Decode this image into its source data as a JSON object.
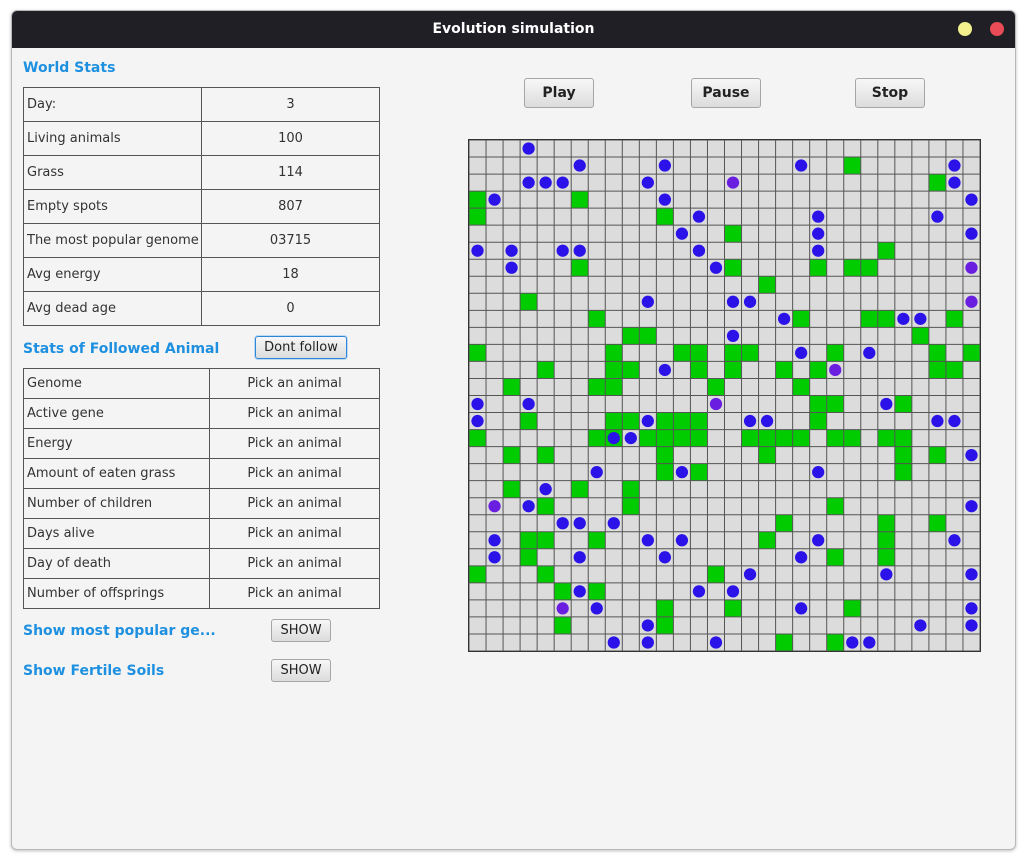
{
  "window": {
    "title": "Evolution simulation",
    "colors": {
      "titlebar": "#1f1f25",
      "minimize": "#f3f08d",
      "close": "#ea4c57"
    }
  },
  "world_stats": {
    "title": "World Stats",
    "rows": [
      {
        "label": "Day:",
        "value": "3"
      },
      {
        "label": "Living animals",
        "value": "100"
      },
      {
        "label": "Grass",
        "value": "114"
      },
      {
        "label": "Empty spots",
        "value": "807"
      },
      {
        "label": "The most popular genome",
        "value": "03715"
      },
      {
        "label": "Avg energy",
        "value": "18"
      },
      {
        "label": "Avg dead age",
        "value": "0"
      }
    ]
  },
  "followed": {
    "title": "Stats of Followed Animal",
    "dont_follow_label": "Dont follow",
    "rows": [
      {
        "label": "Genome",
        "value": "Pick an animal"
      },
      {
        "label": "Active gene",
        "value": "Pick an animal"
      },
      {
        "label": "Energy",
        "value": "Pick an animal"
      },
      {
        "label": "Amount of eaten grass",
        "value": "Pick an animal"
      },
      {
        "label": "Number of children",
        "value": "Pick an animal"
      },
      {
        "label": "Days alive",
        "value": "Pick an animal"
      },
      {
        "label": "Day of death",
        "value": "Pick an animal"
      },
      {
        "label": "Number of offsprings",
        "value": "Pick an animal"
      }
    ]
  },
  "genome_toggle": {
    "label": "Show most popular ge...",
    "button": "SHOW"
  },
  "fertile_toggle": {
    "label": "Show Fertile Soils",
    "button": "SHOW"
  },
  "controls": {
    "play": "Play",
    "pause": "Pause",
    "stop": "Stop"
  },
  "map": {
    "cols": 30,
    "rows": 30,
    "colors": {
      "empty": "#dcdcdc",
      "grass": "#00cc00",
      "animal": "#2a12e8",
      "animal_alt": "#6a1fe0",
      "grid": "#555555"
    },
    "grass": [
      [
        22,
        1
      ],
      [
        27,
        2
      ],
      [
        0,
        3
      ],
      [
        6,
        3
      ],
      [
        0,
        4
      ],
      [
        11,
        4
      ],
      [
        15,
        5
      ],
      [
        24,
        6
      ],
      [
        6,
        7
      ],
      [
        15,
        7
      ],
      [
        20,
        7
      ],
      [
        22,
        7
      ],
      [
        23,
        7
      ],
      [
        17,
        8
      ],
      [
        3,
        9
      ],
      [
        7,
        10
      ],
      [
        19,
        10
      ],
      [
        23,
        10
      ],
      [
        24,
        10
      ],
      [
        28,
        10
      ],
      [
        9,
        11
      ],
      [
        10,
        11
      ],
      [
        26,
        11
      ],
      [
        0,
        12
      ],
      [
        8,
        12
      ],
      [
        12,
        12
      ],
      [
        13,
        12
      ],
      [
        15,
        12
      ],
      [
        16,
        12
      ],
      [
        21,
        12
      ],
      [
        27,
        12
      ],
      [
        29,
        12
      ],
      [
        4,
        13
      ],
      [
        8,
        13
      ],
      [
        9,
        13
      ],
      [
        13,
        13
      ],
      [
        15,
        13
      ],
      [
        18,
        13
      ],
      [
        20,
        13
      ],
      [
        27,
        13
      ],
      [
        28,
        13
      ],
      [
        2,
        14
      ],
      [
        7,
        14
      ],
      [
        8,
        14
      ],
      [
        14,
        14
      ],
      [
        19,
        14
      ],
      [
        20,
        15
      ],
      [
        21,
        15
      ],
      [
        25,
        15
      ],
      [
        3,
        16
      ],
      [
        8,
        16
      ],
      [
        9,
        16
      ],
      [
        11,
        16
      ],
      [
        12,
        16
      ],
      [
        13,
        16
      ],
      [
        20,
        16
      ],
      [
        0,
        17
      ],
      [
        7,
        17
      ],
      [
        8,
        17
      ],
      [
        10,
        17
      ],
      [
        11,
        17
      ],
      [
        12,
        17
      ],
      [
        13,
        17
      ],
      [
        16,
        17
      ],
      [
        17,
        17
      ],
      [
        18,
        17
      ],
      [
        19,
        17
      ],
      [
        21,
        17
      ],
      [
        22,
        17
      ],
      [
        24,
        17
      ],
      [
        25,
        17
      ],
      [
        2,
        18
      ],
      [
        4,
        18
      ],
      [
        11,
        18
      ],
      [
        17,
        18
      ],
      [
        25,
        18
      ],
      [
        27,
        18
      ],
      [
        11,
        19
      ],
      [
        13,
        19
      ],
      [
        25,
        19
      ],
      [
        2,
        20
      ],
      [
        6,
        20
      ],
      [
        9,
        20
      ],
      [
        4,
        21
      ],
      [
        9,
        21
      ],
      [
        21,
        21
      ],
      [
        18,
        22
      ],
      [
        24,
        22
      ],
      [
        27,
        22
      ],
      [
        3,
        23
      ],
      [
        4,
        23
      ],
      [
        7,
        23
      ],
      [
        17,
        23
      ],
      [
        24,
        23
      ],
      [
        3,
        24
      ],
      [
        21,
        24
      ],
      [
        24,
        24
      ],
      [
        0,
        25
      ],
      [
        4,
        25
      ],
      [
        14,
        25
      ],
      [
        5,
        26
      ],
      [
        7,
        26
      ],
      [
        11,
        27
      ],
      [
        15,
        27
      ],
      [
        22,
        27
      ],
      [
        5,
        28
      ],
      [
        11,
        28
      ],
      [
        18,
        29
      ],
      [
        21,
        29
      ]
    ],
    "animals": [
      [
        3,
        0
      ],
      [
        6,
        1
      ],
      [
        11,
        1
      ],
      [
        19,
        1
      ],
      [
        28,
        1
      ],
      [
        3,
        2
      ],
      [
        4,
        2
      ],
      [
        5,
        2
      ],
      [
        10,
        2
      ],
      [
        15,
        2
      ],
      [
        28,
        2
      ],
      [
        1,
        3
      ],
      [
        11,
        3
      ],
      [
        29,
        3
      ],
      [
        13,
        4
      ],
      [
        20,
        4
      ],
      [
        27,
        4
      ],
      [
        12,
        5
      ],
      [
        20,
        5
      ],
      [
        29,
        5
      ],
      [
        0,
        6
      ],
      [
        2,
        6
      ],
      [
        5,
        6
      ],
      [
        6,
        6
      ],
      [
        13,
        6
      ],
      [
        20,
        6
      ],
      [
        2,
        7
      ],
      [
        14,
        7
      ],
      [
        29,
        7
      ],
      [
        10,
        9
      ],
      [
        15,
        9
      ],
      [
        16,
        9
      ],
      [
        29,
        9
      ],
      [
        18,
        10
      ],
      [
        25,
        10
      ],
      [
        26,
        10
      ],
      [
        15,
        11
      ],
      [
        19,
        12
      ],
      [
        23,
        12
      ],
      [
        11,
        13
      ],
      [
        21,
        13
      ],
      [
        0,
        15
      ],
      [
        3,
        15
      ],
      [
        14,
        15
      ],
      [
        24,
        15
      ],
      [
        0,
        16
      ],
      [
        10,
        16
      ],
      [
        16,
        16
      ],
      [
        17,
        16
      ],
      [
        27,
        16
      ],
      [
        28,
        16
      ],
      [
        8,
        17
      ],
      [
        9,
        17
      ],
      [
        29,
        18
      ],
      [
        7,
        19
      ],
      [
        12,
        19
      ],
      [
        20,
        19
      ],
      [
        4,
        20
      ],
      [
        1,
        21
      ],
      [
        3,
        21
      ],
      [
        29,
        21
      ],
      [
        5,
        22
      ],
      [
        6,
        22
      ],
      [
        8,
        22
      ],
      [
        1,
        23
      ],
      [
        10,
        23
      ],
      [
        12,
        23
      ],
      [
        20,
        23
      ],
      [
        28,
        23
      ],
      [
        1,
        24
      ],
      [
        6,
        24
      ],
      [
        11,
        24
      ],
      [
        19,
        24
      ],
      [
        16,
        25
      ],
      [
        24,
        25
      ],
      [
        29,
        25
      ],
      [
        6,
        26
      ],
      [
        13,
        26
      ],
      [
        15,
        26
      ],
      [
        5,
        27
      ],
      [
        7,
        27
      ],
      [
        19,
        27
      ],
      [
        29,
        27
      ],
      [
        10,
        28
      ],
      [
        26,
        28
      ],
      [
        29,
        28
      ],
      [
        8,
        29
      ],
      [
        10,
        29
      ],
      [
        14,
        29
      ],
      [
        22,
        29
      ],
      [
        23,
        29
      ]
    ],
    "animals_alt": [
      [
        15,
        2
      ],
      [
        29,
        7
      ],
      [
        29,
        9
      ],
      [
        21,
        13
      ],
      [
        14,
        15
      ],
      [
        1,
        21
      ],
      [
        5,
        27
      ]
    ]
  }
}
